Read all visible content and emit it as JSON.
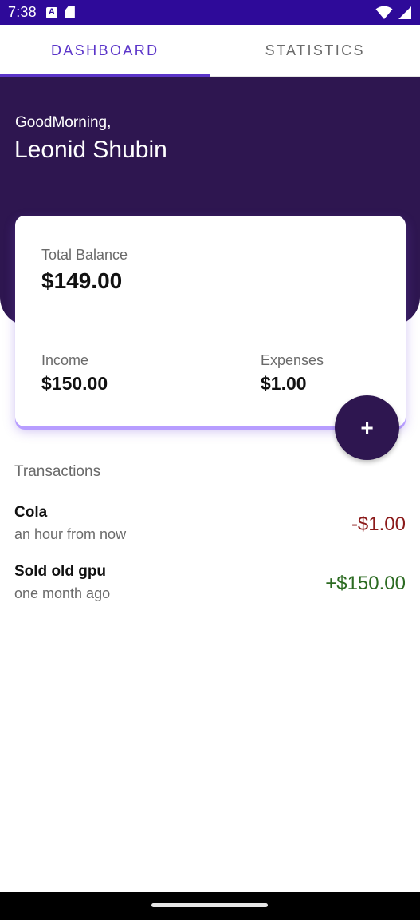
{
  "status_bar": {
    "time": "7:38",
    "icons": [
      "a-notification-icon",
      "sd-card-icon",
      "wifi-icon",
      "signal-icon"
    ]
  },
  "tabs": [
    {
      "label": "DASHBOARD",
      "active": true
    },
    {
      "label": "STATISTICS",
      "active": false
    }
  ],
  "header": {
    "greeting": "GoodMorning,",
    "name": "Leonid Shubin"
  },
  "card": {
    "balance_label": "Total Balance",
    "balance_value": "$149.00",
    "income_label": "Income",
    "income_value": "$150.00",
    "expenses_label": "Expenses",
    "expenses_value": "$1.00"
  },
  "fab": {
    "label": "+"
  },
  "transactions": {
    "title": "Transactions",
    "items": [
      {
        "name": "Cola",
        "time": "an hour from now",
        "amount": "-$1.00",
        "type": "expense"
      },
      {
        "name": "Sold old gpu",
        "time": "one month ago",
        "amount": "+$150.00",
        "type": "income"
      }
    ]
  },
  "colors": {
    "status_bar": "#2e0a99",
    "header": "#2e1650",
    "accent": "#5b35c9",
    "expense": "#8b1a1a",
    "income": "#2c6b22"
  }
}
